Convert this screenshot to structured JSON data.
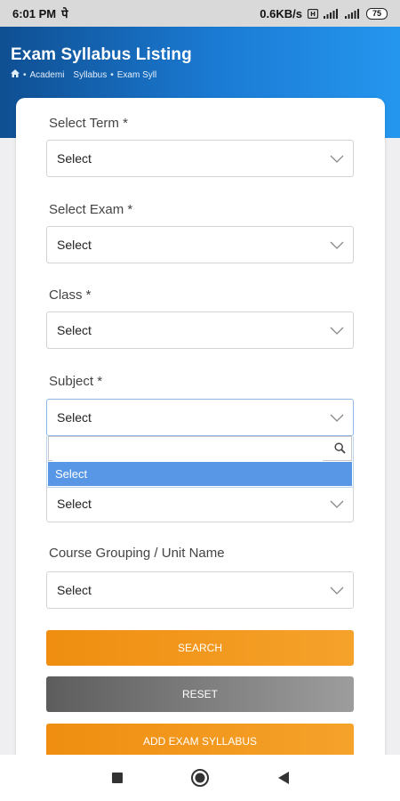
{
  "status_bar": {
    "time": "6:01 PM",
    "extra": "पे",
    "network_speed": "0.6KB/s",
    "battery": "75"
  },
  "header": {
    "title": "Exam Syllabus Listing",
    "breadcrumb": [
      "Academi",
      "Syllabus",
      "Exam Syll"
    ]
  },
  "form": {
    "fields": [
      {
        "label": "Select Term *",
        "value": "Select"
      },
      {
        "label": "Select Exam *",
        "value": "Select"
      },
      {
        "label": "Class *",
        "value": "Select"
      },
      {
        "label": "Subject *",
        "value": "Select"
      },
      {
        "label": "",
        "value": "Select"
      },
      {
        "label": "Course Grouping / Unit Name",
        "value": "Select"
      }
    ],
    "dropdown": {
      "search_value": "",
      "options": [
        "Select"
      ]
    }
  },
  "buttons": {
    "search": "SEARCH",
    "reset": "RESET",
    "add": "ADD EXAM SYLLABUS"
  },
  "icons": {
    "home": "home-icon",
    "chevron": "chevron-down-icon",
    "search": "search-icon",
    "nav_recent": "stop-square-icon",
    "nav_home": "circle-home-icon",
    "nav_back": "back-triangle-icon"
  },
  "colors": {
    "header_start": "#0f4f92",
    "header_end": "#2596ee",
    "orange": "#ef8e10",
    "gray": "#5d5d5d",
    "dropdown_highlight": "#5897e6"
  }
}
